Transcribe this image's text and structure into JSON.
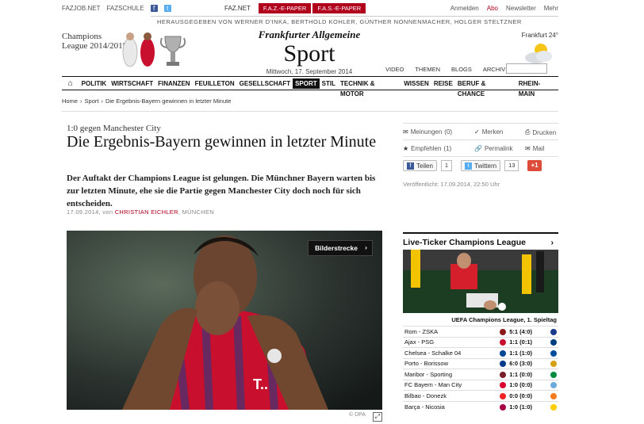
{
  "topbar": {
    "fazjob": "FAZJOB.NET",
    "fazschule": "FAZSCHULE",
    "faznet": "FAZ.NET",
    "epaper1": "F.A.Z.-E-PAPER",
    "epaper2": "F.A.S.-E-PAPER",
    "anmelden": "Anmelden",
    "abo": "Abo",
    "newsletter": "Newsletter",
    "mehr": "Mehr",
    "publishers": "HERAUSGEGEBEN VON WERNER D'INKA, BERTHOLD KOHLER, GÜNTHER NONNENMACHER, HOLGER STELTZNER"
  },
  "masthead": {
    "promo_line1": "Champions",
    "promo_line2": "League 2014/2015",
    "paper": "Frankfurter Allgemeine",
    "section": "Sport",
    "date": "Mittwoch, 17. September 2014",
    "weather_city": "Frankfurt 24°"
  },
  "subnav": [
    "VIDEO",
    "THEMEN",
    "BLOGS",
    "ARCHIV"
  ],
  "nav": [
    "POLITIK",
    "WIRTSCHAFT",
    "FINANZEN",
    "FEUILLETON",
    "GESELLSCHAFT",
    "SPORT",
    "STIL",
    "TECHNIK & MOTOR",
    "WISSEN",
    "REISE",
    "BERUF & CHANCE",
    "RHEIN-MAIN"
  ],
  "breadcrumb": {
    "home": "Home",
    "sport": "Sport",
    "current": "Die Ergebnis-Bayern gewinnen in letzter Minute"
  },
  "article": {
    "kicker": "1:0 gegen Manchester City",
    "headline": "Die Ergebnis-Bayern gewinnen in letzter Minute",
    "teaser": "Der Auftakt der Champions League ist gelungen. Die Münchner Bayern warten bis zur letzten Minute, ehe sie die Partie gegen Manchester City doch noch für sich entscheiden.",
    "date": "17.09.2014, von",
    "author": "CHRISTIAN EICHLER",
    "location": ", MÜNCHEN",
    "gallery_button": "Bilderstrecke",
    "photo_credit": "© DPA"
  },
  "tools": {
    "meinungen": "Meinungen",
    "meinungen_count": "(0)",
    "merken": "Merken",
    "drucken": "Drucken",
    "empfehlen": "Empfehlen",
    "empfehlen_count": "(1)",
    "permalink": "Permalink",
    "mail": "Mail",
    "teilen": "Teilen",
    "teilen_count": "1",
    "twittern": "Twittern",
    "twittern_count": "13",
    "gplus": "+1",
    "published": "Veröffentlicht: 17.09.2014, 22:50 Uhr"
  },
  "ticker": {
    "title": "Live-Ticker Champions League",
    "league": "UEFA Champions League, 1. Spieltag",
    "matches": [
      {
        "teams": "Rom - ZSKA",
        "score": "5:1 (4:0)",
        "home_color": "#8b1a1a",
        "away_color": "#1a3a8b"
      },
      {
        "teams": "Ajax - PSG",
        "score": "1:1 (0:1)",
        "home_color": "#c8102e",
        "away_color": "#003f7f"
      },
      {
        "teams": "Chelsea - Schalke 04",
        "score": "1:1 (1:0)",
        "home_color": "#034694",
        "away_color": "#004d9d"
      },
      {
        "teams": "Porto - Borissow",
        "score": "6:0 (3:0)",
        "home_color": "#003a8c",
        "away_color": "#d4a017"
      },
      {
        "teams": "Maribor - Sporting",
        "score": "1:1 (0:0)",
        "home_color": "#7a1d2a",
        "away_color": "#008a3e"
      },
      {
        "teams": "FC Bayern - Man City",
        "score": "1:0 (0:0)",
        "home_color": "#dc052d",
        "away_color": "#6cabdd"
      },
      {
        "teams": "Bilbao - Donezk",
        "score": "0:0 (0:0)",
        "home_color": "#ee2523",
        "away_color": "#f47a20"
      },
      {
        "teams": "Barça - Nicosia",
        "score": "1:0 (1:0)",
        "home_color": "#a50044",
        "away_color": "#ffcc00"
      }
    ]
  }
}
